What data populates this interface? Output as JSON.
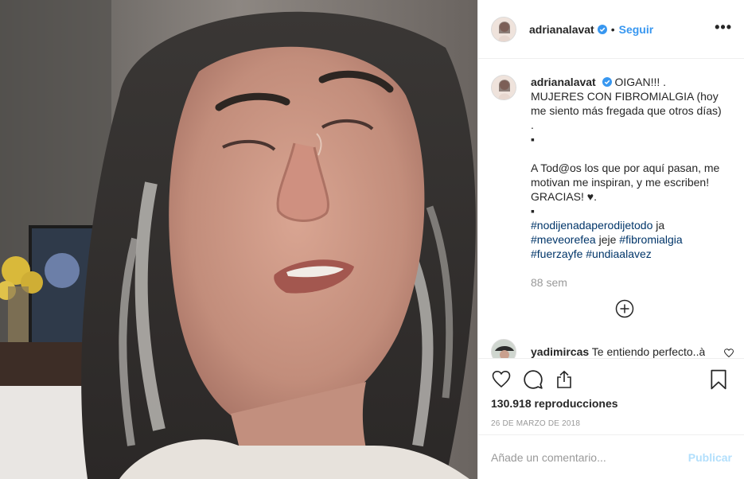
{
  "post": {
    "username": "adrianalavat",
    "follow_label": "Seguir",
    "dot": "•",
    "more_label": "•••",
    "caption": {
      "username": "adrianalavat",
      "line1": " OIGAN!!! .",
      "line2": "MUJERES CON FIBROMIALGIA (hoy me siento más fregada que otros días)",
      "line3": ".",
      "line4": "▪",
      "line5": "A Tod@os los que por aquí pasan, me motivan me inspiran, y me escriben! GRACIAS! ♥.",
      "line6": "▪",
      "hashtag1": "#nodijenadaperodijetodo",
      "word1": " ja",
      "hashtag2": "#meveorefea",
      "word2": " jeje ",
      "hashtag3": "#fibromialgia",
      "hashtag4": "#fuerzayfe",
      "hashtag5": "#undiaalavez"
    },
    "time_ago": "88 sem",
    "comment": {
      "username": "yadimircas",
      "text": " Te entiendo perfecto..à"
    },
    "views": "130.918 reproducciones",
    "date": "26 DE MARZO DE 2018",
    "add_comment_placeholder": "Añade un comentario...",
    "publish_label": "Publicar"
  },
  "colors": {
    "accent": "#3897f0",
    "verified": "#3897f0",
    "hashtag": "#003569",
    "muted": "#999999",
    "publish_disabled": "#b2dffc"
  },
  "icons": [
    "verified-badge-icon",
    "more-options-icon",
    "add-circle-icon",
    "heart-icon",
    "comment-icon",
    "share-icon",
    "bookmark-icon"
  ]
}
